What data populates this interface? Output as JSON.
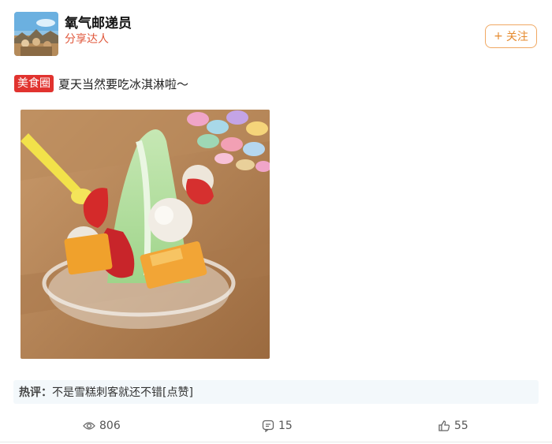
{
  "author": {
    "name": "氧气邮递员",
    "tag": "分享达人"
  },
  "follow": {
    "plus": "+",
    "label": "关注"
  },
  "post": {
    "topic": "美食圈",
    "text": "夏天当然要吃冰淇淋啦～"
  },
  "hot_comment": {
    "label": "热评：",
    "text": "不是雪糕刺客就还不错[点赞]"
  },
  "stats": {
    "views": "806",
    "comments": "15",
    "likes": "55"
  },
  "colors": {
    "accent": "#e58a2e",
    "tag_red": "#e1332f",
    "author_tag": "#e0573b",
    "comment_bg": "#f3f8fb"
  },
  "icons": {
    "views": "eye-icon",
    "comments": "comment-icon",
    "likes": "thumbs-up-icon"
  }
}
